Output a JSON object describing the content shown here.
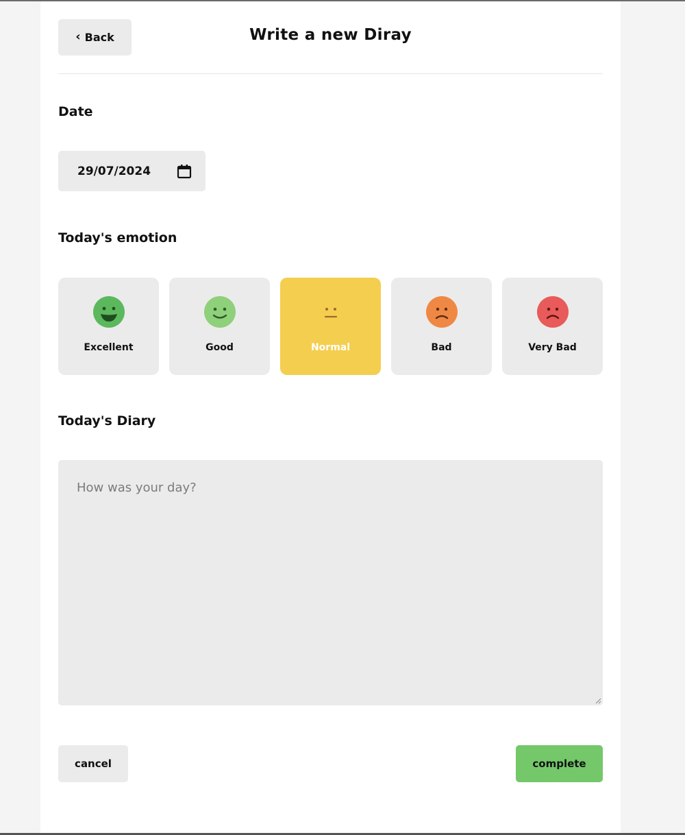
{
  "header": {
    "back_label": "Back",
    "title": "Write a new Diray"
  },
  "date_section": {
    "label": "Date",
    "value": "29/07/2024",
    "icon": "calendar-icon"
  },
  "emotion_section": {
    "label": "Today's emotion",
    "selected": "Normal",
    "options": [
      {
        "label": "Excellent",
        "icon": "excellent-face-icon",
        "color": "#5cb85c"
      },
      {
        "label": "Good",
        "icon": "good-face-icon",
        "color": "#8fd07a"
      },
      {
        "label": "Normal",
        "icon": "normal-face-icon",
        "color": "#f4ce4e"
      },
      {
        "label": "Bad",
        "icon": "bad-face-icon",
        "color": "#ef8844"
      },
      {
        "label": "Very Bad",
        "icon": "very-bad-face-icon",
        "color": "#e95a5a"
      }
    ]
  },
  "diary_section": {
    "label": "Today's Diary",
    "placeholder": "How was your day?",
    "value": ""
  },
  "actions": {
    "cancel_label": "cancel",
    "complete_label": "complete"
  },
  "colors": {
    "page_background": "#f4f4f4",
    "card_background": "#ffffff",
    "control_background": "#ebebeb",
    "selected_emotion": "#f4ce4e",
    "complete_button": "#74c86a"
  }
}
